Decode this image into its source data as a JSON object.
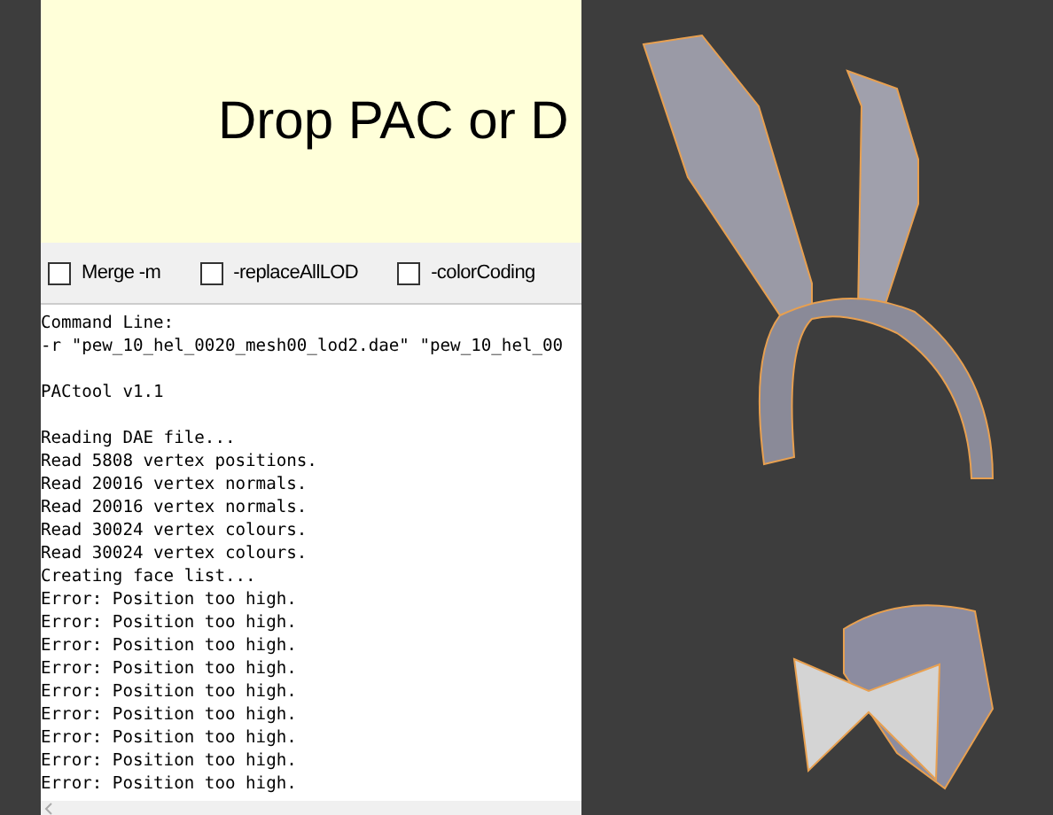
{
  "drop_area": {
    "text": "Drop PAC or D"
  },
  "options": [
    {
      "label": "Merge -m",
      "checked": false
    },
    {
      "label": "-replaceAllLOD",
      "checked": false
    },
    {
      "label": "-colorCoding",
      "checked": false
    }
  ],
  "log": [
    [
      "Command Line:",
      "-r \"pew_10_hel_0020_mesh00_lod2.dae\" \"pew_10_hel_00"
    ],
    [
      "PACtool v1.1"
    ],
    [
      "Reading DAE file...",
      "Read 5808 vertex positions.",
      "Read 20016 vertex normals.",
      "Read 20016 vertex normals.",
      "Read 30024 vertex colours.",
      "Read 30024 vertex colours.",
      "Creating face list...",
      "Error: Position too high.",
      "Error: Position too high.",
      "Error: Position too high.",
      "Error: Position too high.",
      "Error: Position too high.",
      "Error: Position too high.",
      "Error: Position too high.",
      "Error: Position too high.",
      "Error: Position too high."
    ]
  ]
}
